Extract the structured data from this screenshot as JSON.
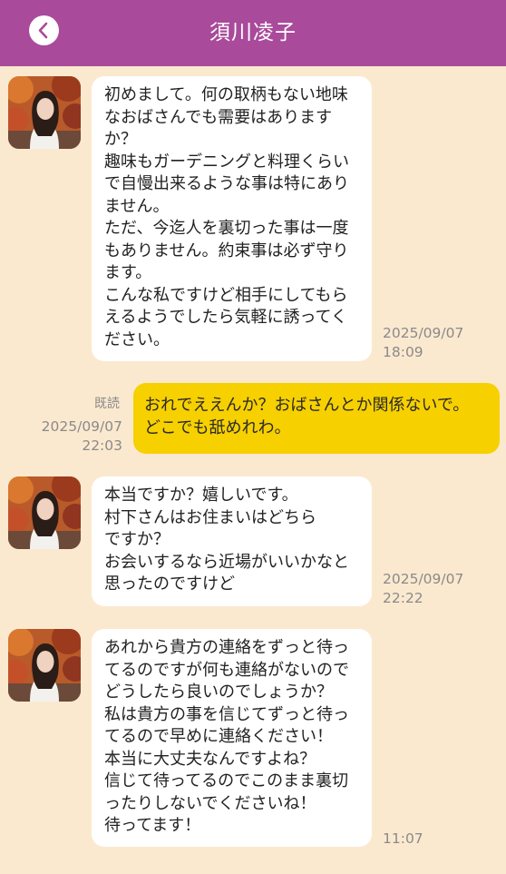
{
  "header": {
    "back_icon": "chevron-left-icon",
    "title": "須川凌子"
  },
  "colors": {
    "header_bg": "#a94a9b",
    "chat_bg": "#fbe9cf",
    "incoming_bubble": "#ffffff",
    "outgoing_bubble": "#f7d000"
  },
  "messages": [
    {
      "direction": "incoming",
      "text": "初めまして。何の取柄もない地味\nなおばさんでも需要はあります\nか？\n趣味もガーデニングと料理くらい\nで自慢出来るような事は特にあり\nません。\nただ、今迄人を裏切った事は一度\nもありません。約束事は必ず守り\nます。\nこんな私ですけど相手にしてもら\nえるようでしたら気軽に誘ってく\nださい。",
      "timestamp": "2025/09/07\n18:09"
    },
    {
      "direction": "outgoing",
      "read": "既読",
      "text": "おれでええんか？おばさんとか関係ないで。\nどこでも舐めれわ。",
      "timestamp": "2025/09/07\n22:03"
    },
    {
      "direction": "incoming",
      "text": "本当ですか？嬉しいです。\n村下さんはお住まいはどちら\nですか？\nお会いするなら近場がいいかなと\n思ったのですけど",
      "timestamp": "2025/09/07\n22:22"
    },
    {
      "direction": "incoming",
      "text": "あれから貴方の連絡をずっと待っ\nてるのですが何も連絡がないので\nどうしたら良いのでしょうか？\n私は貴方の事を信じてずっと待っ\nてるので早めに連絡ください！\n本当に大丈夫なんですよね？\n信じて待ってるのでこのまま裏切\nったりしないでくださいね！\n待ってます！",
      "timestamp": "11:07"
    }
  ]
}
